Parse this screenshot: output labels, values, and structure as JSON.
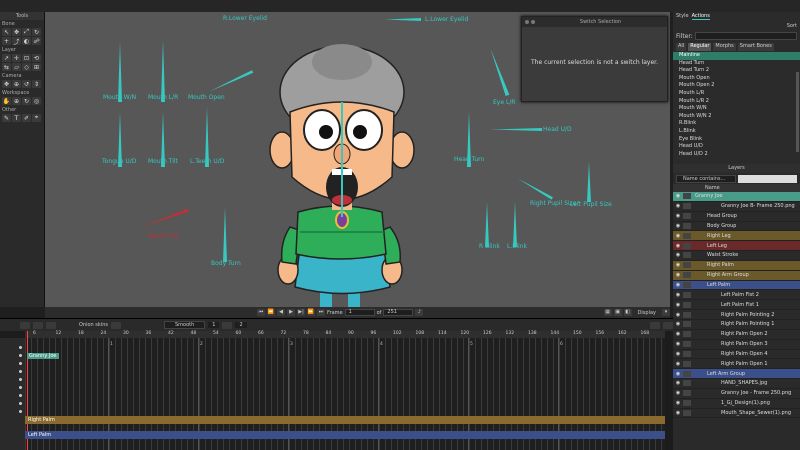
{
  "tools_panel": {
    "title": "Tools",
    "sections": [
      "Bone",
      "Layer",
      "Camera",
      "Workspace",
      "Other"
    ]
  },
  "canvas": {
    "bone_labels": [
      "R.Lower Eyelid",
      "L.Lower Eyelid",
      "Mouth W/N",
      "Mouth L/R",
      "Mouth Open",
      "Eye L/R",
      "Head U/D",
      "Head Turn",
      "Tongue U/D",
      "Mouth Tilt",
      "L.Teeth U/D",
      "Right Pupil Size",
      "Left Pupil Size",
      "R Blink",
      "L.Blink",
      "Body Turn",
      "Mouth Tilt"
    ]
  },
  "switch_popup": {
    "title": "Switch Selection",
    "message": "The current selection is not a switch layer."
  },
  "style_panel": {
    "tabs": [
      "Style",
      "Actions"
    ],
    "sort_label": "Sort",
    "filter_label": "Filter:",
    "filter_value": "",
    "subtabs": [
      "All",
      "Regular",
      "Morphs",
      "Smart Bones"
    ],
    "actions": [
      "Mainline",
      "Head Turn",
      "Head Turn 2",
      "Mouth Open",
      "Mouth Open 2",
      "Mouth L/R",
      "Mouth L/R 2",
      "Mouth W/N",
      "Mouth W/N 2",
      "R.Blink",
      "L.Blink",
      "Eye Blink",
      "Head U/D",
      "Head U/D 2"
    ]
  },
  "layers_panel": {
    "title": "Layers",
    "search_mode": "Name contains...",
    "search_value": "",
    "column_name": "Name",
    "rows": [
      {
        "name": "Granny Joe"
      },
      {
        "name": "Granny Joe B- Frame 250.png"
      },
      {
        "name": "Head Group"
      },
      {
        "name": "Body Group"
      },
      {
        "name": "Right Leg"
      },
      {
        "name": "Left Leg"
      },
      {
        "name": "Waist Stroke"
      },
      {
        "name": "Right Palm"
      },
      {
        "name": "Right Arm Group"
      },
      {
        "name": "Left Palm"
      },
      {
        "name": "Left Palm Fist 2"
      },
      {
        "name": "Left Palm Fist 1"
      },
      {
        "name": "Right Palm Pointing 2"
      },
      {
        "name": "Right Palm Pointing 1"
      },
      {
        "name": "Right Palm Open 2"
      },
      {
        "name": "Right Palm Open 3"
      },
      {
        "name": "Right Palm Open 4"
      },
      {
        "name": "Right Palm Open 1"
      },
      {
        "name": "Left Arm Group"
      },
      {
        "name": "HAND_SHAPES.jpg"
      },
      {
        "name": "Granny Joe - Frame 250.png"
      },
      {
        "name": "1_Gj_Design(1).png"
      },
      {
        "name": "Mouth_Shape_Sewer(1).png"
      }
    ]
  },
  "playback": {
    "frame_label": "Frame",
    "frame_value": "1",
    "of_label": "of",
    "total_frames": "251",
    "display_label": "Display"
  },
  "timeline": {
    "smooth_label": "Smooth",
    "onion_label": "Onion skins",
    "ruler": [
      "6",
      "12",
      "18",
      "24",
      "30",
      "36",
      "42",
      "48",
      "54",
      "60",
      "66",
      "72",
      "78",
      "84",
      "90",
      "96",
      "102",
      "108",
      "114",
      "120",
      "126",
      "132",
      "138",
      "144",
      "150",
      "156",
      "162",
      "168"
    ],
    "markers": [
      "1",
      "2",
      "3",
      "4",
      "5",
      "6"
    ],
    "track_label": "Granny Joe",
    "band1": "Right Palm",
    "band2": "Left Palm",
    "field_1": "1",
    "field_2": "2"
  },
  "colors": {
    "bone": "#37c8c0",
    "track_right_palm": "#8a6a2e",
    "track_left_palm": "#3b4f8a"
  }
}
